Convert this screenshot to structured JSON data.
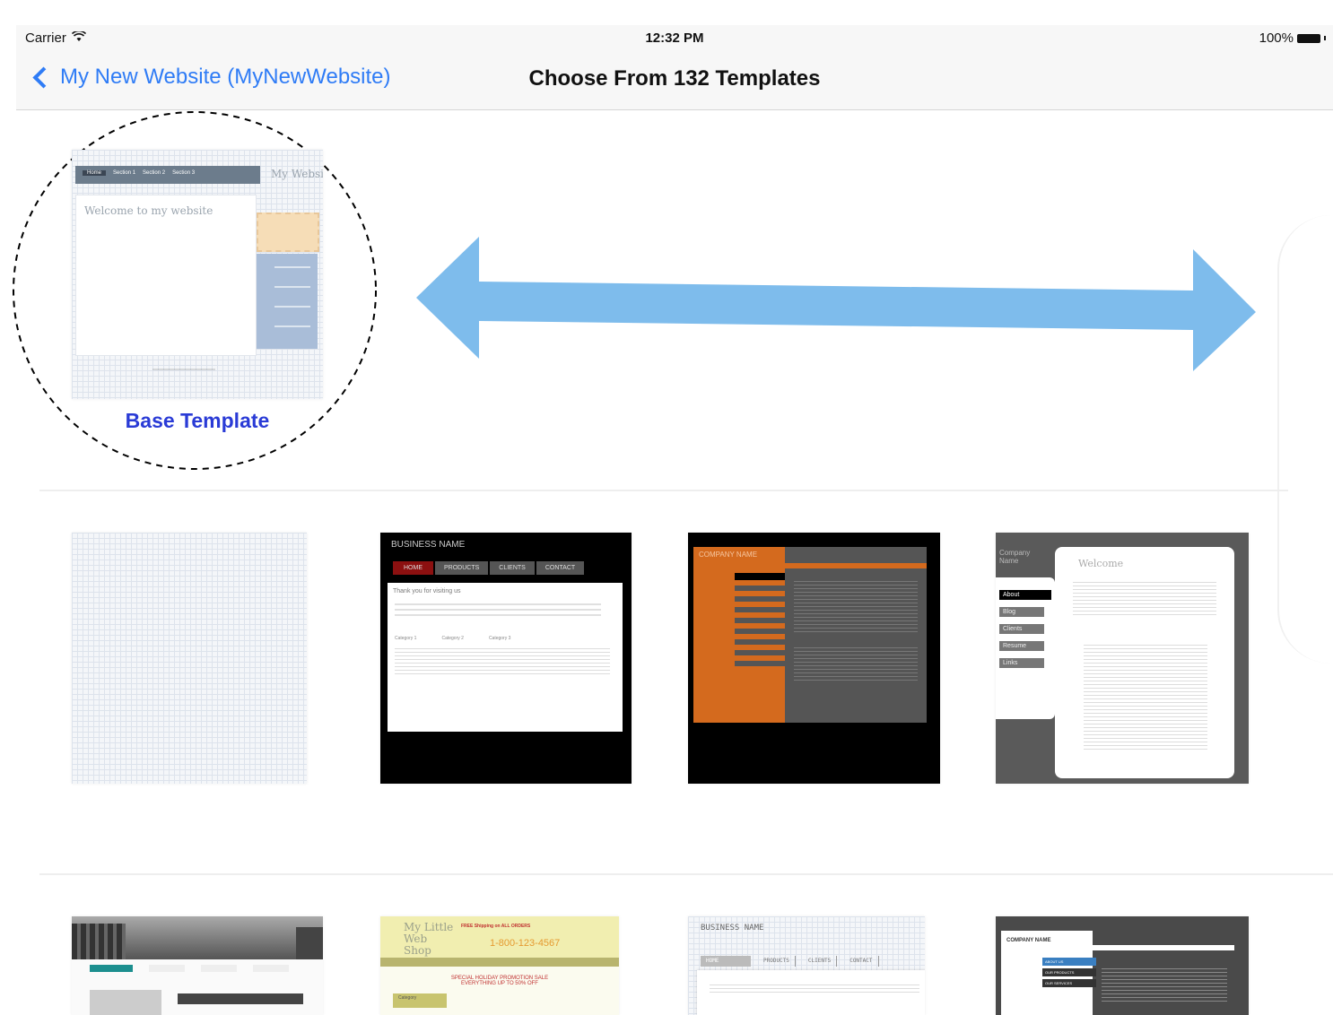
{
  "status_bar": {
    "carrier": "Carrier",
    "time": "12:32 PM",
    "battery": "100%"
  },
  "nav": {
    "back_label": "My New Website (MyNewWebsite)",
    "title": "Choose From 132 Templates"
  },
  "base_template": {
    "label": "Base Template",
    "nav_items": [
      "Home",
      "Section 1",
      "Section 2",
      "Section 3"
    ],
    "header_text": "My Websi",
    "welcome_text": "Welcome to my website"
  },
  "templates_row2": [
    {
      "name": "blank-grid"
    },
    {
      "name": "business-black",
      "brand": "BUSINESS NAME",
      "nav": [
        "HOME",
        "PRODUCTS",
        "CLIENTS",
        "CONTACT"
      ],
      "headline": "Thank you for visiting us",
      "columns": [
        "Category 1",
        "Category 2",
        "Category 3"
      ]
    },
    {
      "name": "company-orange",
      "brand": "COMPANY NAME"
    },
    {
      "name": "company-gray",
      "brand": "Company Name",
      "welcome": "Welcome",
      "nav": [
        "About",
        "Blog",
        "Clients",
        "Resume",
        "Links"
      ]
    }
  ],
  "templates_row3": [
    {
      "name": "city-photo"
    },
    {
      "name": "web-shop",
      "brand": "My Little Web Shop",
      "promo": "FREE Shipping on ALL ORDERS",
      "phone": "1-800-123-4567",
      "sale": "SPECIAL HOLIDAY PROMOTION SALE",
      "sale2": "EVERYTHING UP TO 50% OFF",
      "category": "Category"
    },
    {
      "name": "business-tabs",
      "brand": "BUSINESS NAME",
      "nav": [
        "HOME",
        "PRODUCTS",
        "CLIENTS",
        "CONTACT"
      ]
    },
    {
      "name": "company-dark",
      "brand": "COMPANY NAME",
      "nav": [
        "ABOUT US",
        "OUR PRODUCTS",
        "OUR SERVICES"
      ]
    }
  ],
  "colors": {
    "accent": "#2f7cf6",
    "arrow": "#7ebcec",
    "label": "#2a3bd6",
    "orange": "#d46a1e"
  }
}
